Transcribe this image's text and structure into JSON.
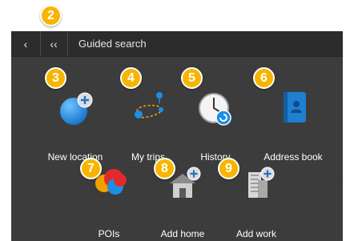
{
  "header": {
    "back_glyph": "‹",
    "back_all_glyph": "‹‹",
    "title": "Guided search"
  },
  "badges": {
    "b2": "2",
    "b3": "3",
    "b4": "4",
    "b5": "5",
    "b6": "6",
    "b7": "7",
    "b8": "8",
    "b9": "9"
  },
  "items": [
    {
      "label": "New location",
      "icon": "new-location-icon"
    },
    {
      "label": "My trips",
      "icon": "my-trips-icon"
    },
    {
      "label": "History",
      "icon": "history-icon"
    },
    {
      "label": "Address book",
      "icon": "address-book-icon"
    },
    {
      "label": "POIs",
      "icon": "pois-icon"
    },
    {
      "label": "Add home",
      "icon": "add-home-icon"
    },
    {
      "label": "Add work",
      "icon": "add-work-icon"
    }
  ],
  "colors": {
    "badge": "#f7b500",
    "background": "#3b3b3c",
    "header": "#2c2c2d",
    "accent_blue": "#1c8ee6"
  }
}
